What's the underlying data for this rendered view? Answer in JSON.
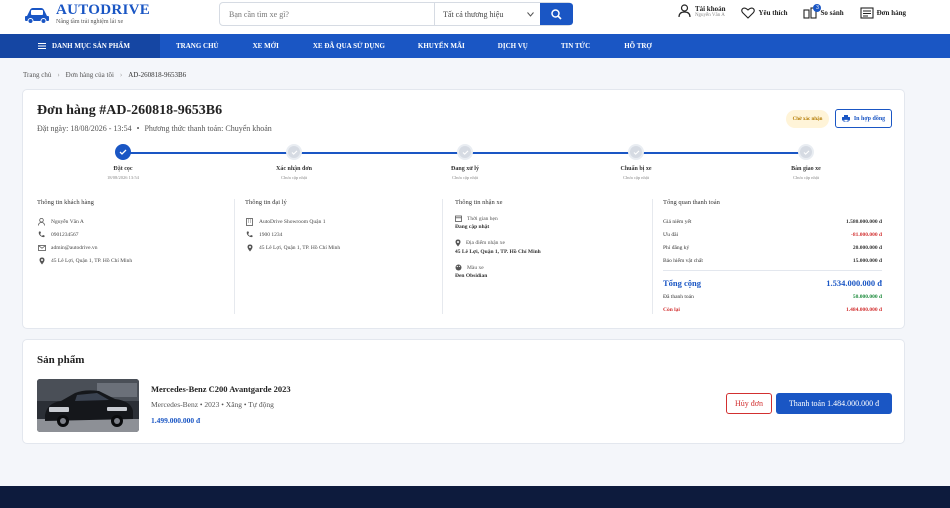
{
  "header": {
    "brand": "AUTODRIVE",
    "tagline": "Nâng tầm trải nghiệm lái xe",
    "search_placeholder": "Bạn cần tìm xe gì?",
    "brand_filter": "Tất cả thương hiệu",
    "account_label": "Tài khoản",
    "account_user": "Nguyễn Văn A",
    "wishlist_label": "Yêu thích",
    "compare_label": "So sánh",
    "compare_count": "3",
    "orders_label": "Đơn hàng"
  },
  "nav": {
    "category_label": "DANH MỤC SẢN PHẨM",
    "links": [
      "TRANG CHỦ",
      "XE MỚI",
      "XE ĐÃ QUA SỬ DỤNG",
      "KHUYẾN MÃI",
      "DỊCH VỤ",
      "TIN TỨC",
      "HỖ TRỢ"
    ]
  },
  "breadcrumb": {
    "home": "Trang chủ",
    "orders": "Đơn hàng của tôi",
    "current": "AD-260818-9653B6"
  },
  "order": {
    "title": "Đơn hàng #AD-260818-9653B6",
    "date_text": "Đặt ngày: 18/08/2026 - 13:54",
    "payment_text": "Phương thức thanh toán: Chuyển khoản",
    "status": "Chờ xác nhận",
    "print_label": "In hợp đồng",
    "steps": [
      {
        "label": "Đặt cọc",
        "time": "18/08/2026 13:54",
        "done": true
      },
      {
        "label": "Xác nhận đơn",
        "time": "Chưa cập nhật",
        "done": false
      },
      {
        "label": "Đang xử lý",
        "time": "Chưa cập nhật",
        "done": false
      },
      {
        "label": "Chuẩn bị xe",
        "time": "Chưa cập nhật",
        "done": false
      },
      {
        "label": "Bàn giao xe",
        "time": "Chưa cập nhật",
        "done": false
      }
    ],
    "customer": {
      "title": "Thông tin khách hàng",
      "name": "Nguyễn Văn A",
      "phone": "0901234567",
      "email": "admin@autodrive.vn",
      "address": "45 Lê Lợi, Quận 1, TP. Hồ Chí Minh"
    },
    "dealer": {
      "title": "Thông tin đại lý",
      "name": "AutoDrive Showroom Quận 1",
      "phone": "1900 1234",
      "address": "45 Lê Lợi, Quận 1, TP. Hồ Chí Minh"
    },
    "delivery": {
      "title": "Thông tin nhận xe",
      "time_label": "Thời gian hẹn",
      "time_value": "Đang cập nhật",
      "place_label": "Địa điểm nhận xe",
      "place_value": "45 Lê Lợi, Quận 1, TP. Hồ Chí Minh",
      "color_label": "Màu xe",
      "color_value": "Đen Obsidian"
    },
    "summary": {
      "title": "Tổng quan thanh toán",
      "rows": [
        {
          "label": "Giá niêm yết",
          "value": "1.580.000.000 đ"
        },
        {
          "label": "Ưu đãi",
          "value": "-81.000.000 đ"
        },
        {
          "label": "Phí đăng ký",
          "value": "20.000.000 đ"
        },
        {
          "label": "Bảo hiểm vật chất",
          "value": "15.000.000 đ"
        }
      ],
      "total_label": "Tổng cộng",
      "total_value": "1.534.000.000 đ",
      "paid_label": "Đã thanh toán",
      "paid_value": "50.000.000 đ",
      "remaining_label": "Còn lại",
      "remaining_value": "1.484.000.000 đ"
    }
  },
  "products": {
    "title": "Sản phẩm",
    "item": {
      "name": "Mercedes-Benz C200 Avantgarde 2023",
      "spec": "Mercedes-Benz • 2023 • Xăng • Tự động",
      "price": "1.499.000.000 đ"
    },
    "cancel_label": "Hủy đơn",
    "pay_label": "Thanh toán 1.484.000.000 đ"
  },
  "colors": {
    "primary": "#1a56c4",
    "danger": "#d23030",
    "success": "#1a8a3a",
    "footer": "#0d1b3d"
  }
}
